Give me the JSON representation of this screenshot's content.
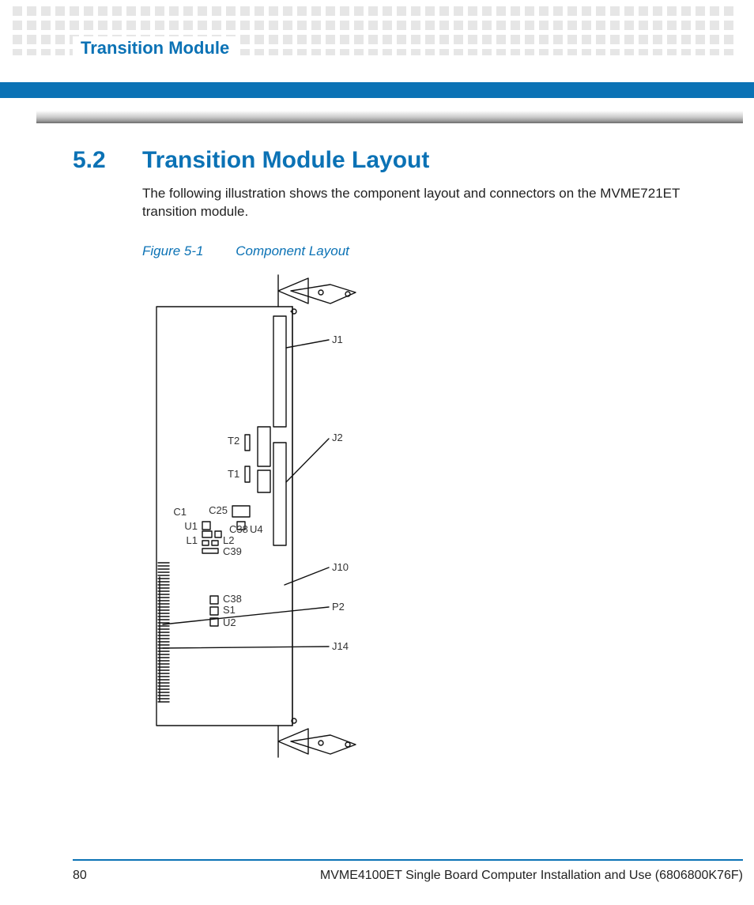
{
  "header": {
    "chapter_title": "Transition Module"
  },
  "section": {
    "number": "5.2",
    "title": "Transition Module Layout",
    "body": "The following illustration shows the component layout and connectors on the MVME721ET transition module."
  },
  "figure": {
    "caption_number": "Figure 5-1",
    "caption_text": "Component Layout",
    "labels": {
      "J1": "J1",
      "J2": "J2",
      "J10": "J10",
      "P2": "P2",
      "J14": "J14",
      "T2": "T2",
      "T1": "T1",
      "C1": "C1",
      "C25": "C25",
      "U1": "U1",
      "C38a": "C38",
      "U4": "U4",
      "L1": "L1",
      "L2": "L2",
      "C39": "C39",
      "C38b": "C38",
      "S1": "S1",
      "U2": "U2"
    }
  },
  "footer": {
    "page": "80",
    "doc_title": "MVME4100ET Single Board Computer Installation and Use (6806800K76F)"
  }
}
